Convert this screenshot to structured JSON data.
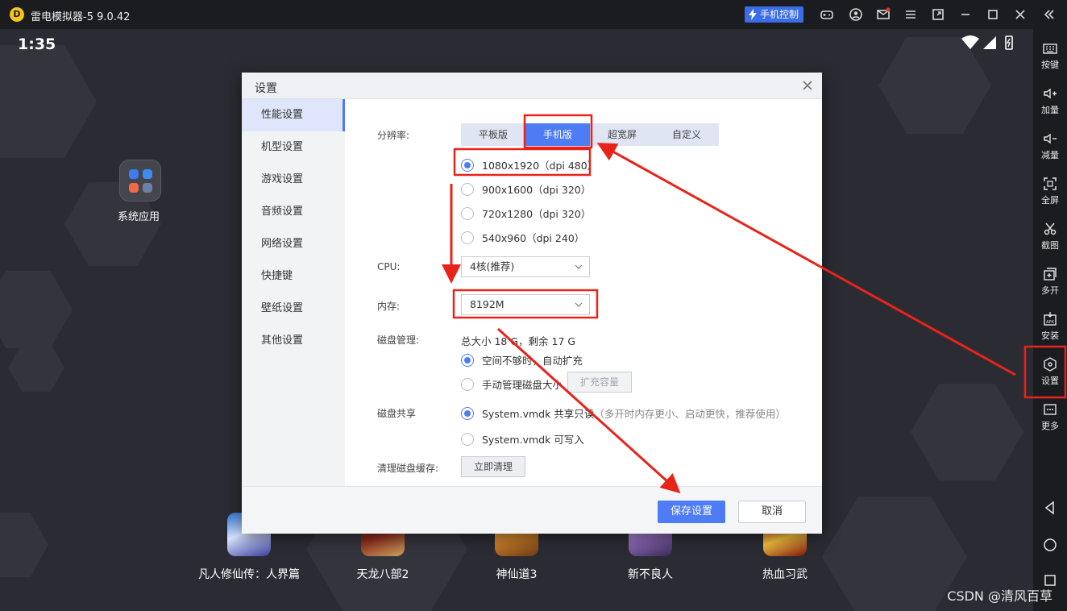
{
  "window": {
    "title": "雷电模拟器-5 9.0.42",
    "phone_control_label": "手机控制",
    "logo_letter": "D"
  },
  "status_bar": {
    "time": "1:35"
  },
  "desktop": {
    "system_apps_label": "系统应用",
    "games": [
      {
        "label": "凡人修仙传：人界篇"
      },
      {
        "label": "天龙八部2"
      },
      {
        "label": "神仙道3"
      },
      {
        "label": "新不良人"
      },
      {
        "label": "热血习武"
      }
    ]
  },
  "sidebar": {
    "items": [
      {
        "label": "按键",
        "icon": "keyboard-icon"
      },
      {
        "label": "加量",
        "icon": "volume-up-icon"
      },
      {
        "label": "减量",
        "icon": "volume-down-icon"
      },
      {
        "label": "全屏",
        "icon": "fullscreen-icon"
      },
      {
        "label": "截图",
        "icon": "scissors-icon"
      },
      {
        "label": "多开",
        "icon": "multi-instance-icon"
      },
      {
        "label": "安装",
        "icon": "apk-install-icon"
      },
      {
        "label": "设置",
        "icon": "settings-hex-icon"
      },
      {
        "label": "更多",
        "icon": "more-icon"
      }
    ],
    "icon_labels": {
      "apk": "APK"
    }
  },
  "dialog": {
    "title": "设置",
    "nav": [
      {
        "label": "性能设置",
        "active": true
      },
      {
        "label": "机型设置"
      },
      {
        "label": "游戏设置"
      },
      {
        "label": "音频设置"
      },
      {
        "label": "网络设置"
      },
      {
        "label": "快捷键"
      },
      {
        "label": "壁纸设置"
      },
      {
        "label": "其他设置"
      }
    ],
    "resolution": {
      "label": "分辨率:",
      "tabs": [
        "平板版",
        "手机版",
        "超宽屏",
        "自定义"
      ],
      "active_tab": "手机版",
      "options": [
        {
          "label": "1080x1920（dpi 480）",
          "selected": true
        },
        {
          "label": "900x1600（dpi 320）"
        },
        {
          "label": "720x1280（dpi 320）"
        },
        {
          "label": "540x960（dpi 240）"
        }
      ]
    },
    "cpu": {
      "label": "CPU:",
      "value": "4核(推荐)"
    },
    "memory": {
      "label": "内存:",
      "value": "8192M"
    },
    "disk": {
      "label": "磁盘管理:",
      "summary": "总大小 18 G，剩余 17 G",
      "options": [
        {
          "label": "空间不够时，自动扩充",
          "selected": true
        },
        {
          "label": "手动管理磁盘大小"
        }
      ],
      "expand_button": "扩充容量"
    },
    "disk_share": {
      "label": "磁盘共享",
      "options": [
        {
          "label": "System.vmdk 共享只读",
          "note": "（多开时内存更小、启动更快，推荐使用）",
          "selected": true
        },
        {
          "label": "System.vmdk 可写入"
        }
      ]
    },
    "cache": {
      "label": "清理磁盘缓存:",
      "button": "立即清理"
    },
    "footer": {
      "save": "保存设置",
      "cancel": "取消"
    }
  },
  "watermark": "CSDN @清风百草",
  "colors": {
    "accent": "#4d7cf4",
    "annotation": "#e8231a",
    "titlebar": "#1b1c20"
  }
}
